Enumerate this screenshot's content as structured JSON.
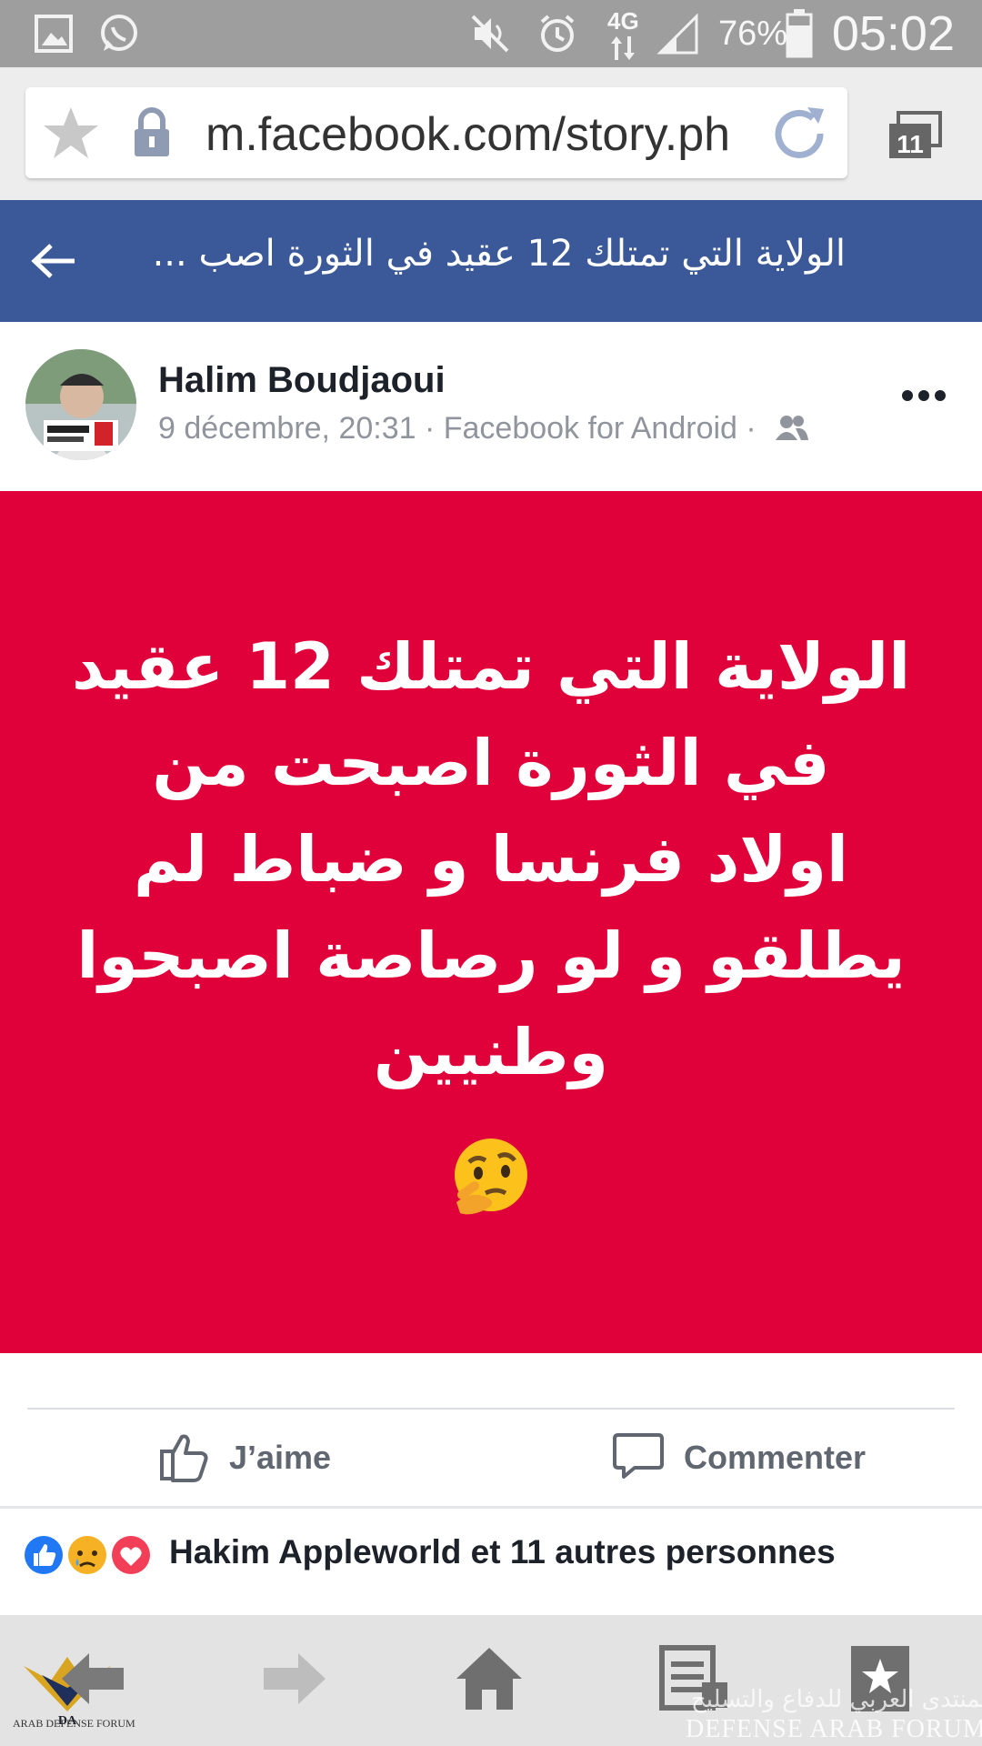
{
  "status_bar": {
    "time": "05:02",
    "battery_percent": "76%",
    "network": "4G",
    "icons": [
      "gallery-icon",
      "whatsapp-icon",
      "mute-icon",
      "alarm-icon",
      "data-arrows-icon",
      "signal-icon",
      "battery-icon"
    ]
  },
  "browser": {
    "url": "m.facebook.com/story.ph",
    "tab_count": "11",
    "icons": [
      "bookmark-star-icon",
      "lock-icon",
      "reload-icon",
      "tabs-icon"
    ]
  },
  "header": {
    "title": "الولاية التي تمتلك 12 عقيد في الثورة اصب  ..."
  },
  "post": {
    "author": "Halim Boudjaoui",
    "meta": "9 décembre, 20:31 · Facebook for Android ·",
    "text_lines": [
      "الولاية التي تمتلك 12 عقيد",
      "في الثورة اصبحت من",
      "اولاد فرنسا و ضباط لم",
      "يطلقو و لو رصاصة اصبحوا",
      "وطنيين"
    ],
    "emoji": "thinking-face-emoji",
    "background_color": "#e0003a"
  },
  "actions": {
    "like_label": "J’aime",
    "comment_label": "Commenter"
  },
  "reactions": {
    "icons": [
      "like-reaction-icon",
      "sad-reaction-icon",
      "love-reaction-icon"
    ],
    "summary": "Hakim Appleworld et 11 autres personnes"
  },
  "bottom_nav": {
    "icons": [
      "back-arrow-icon",
      "forward-arrow-icon",
      "home-icon",
      "menu-icon",
      "bookmarks-icon"
    ]
  },
  "watermark": {
    "arabic": "المنتدى العربي للدفاع والتسليح",
    "english": "DEFENSE ARAB FORUM",
    "logo_text": "ARAB DEFENSE FORUM"
  },
  "colors": {
    "facebook_blue": "#3b5998",
    "post_red": "#e0003a",
    "status_gray": "#9e9e9e"
  }
}
